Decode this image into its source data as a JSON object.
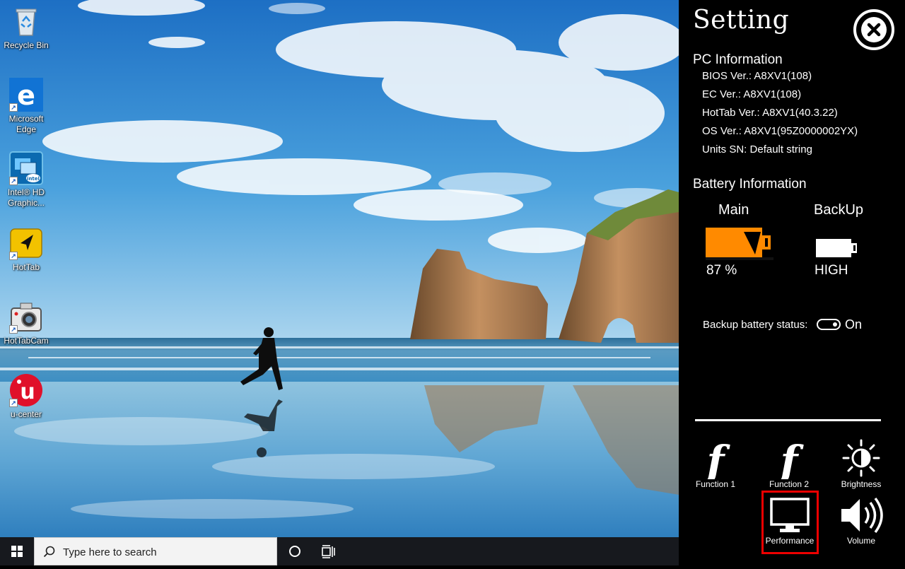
{
  "desktop": {
    "icons": [
      {
        "label": "Recycle Bin",
        "icon": "recycle-bin-icon"
      },
      {
        "label": "Microsoft Edge",
        "icon": "edge-icon"
      },
      {
        "label": "Intel® HD Graphic...",
        "icon": "intel-graphics-icon"
      },
      {
        "label": "HotTab",
        "icon": "hottab-icon"
      },
      {
        "label": "HotTabCam",
        "icon": "camera-icon"
      },
      {
        "label": "u-center",
        "icon": "u-center-icon"
      }
    ]
  },
  "taskbar": {
    "search_placeholder": "Type here to search",
    "icons": [
      "windows-start-icon",
      "search-icon",
      "cortana-icon",
      "task-view-icon"
    ]
  },
  "settings": {
    "title": "Setting",
    "pc_info": {
      "heading": "PC Information",
      "lines": [
        {
          "key": "BIOS Ver.:",
          "value": "A8XV1(108)"
        },
        {
          "key": "EC Ver.:",
          "value": "A8XV1(108)"
        },
        {
          "key": "HotTab Ver.:",
          "value": "A8XV1(40.3.22)"
        },
        {
          "key": "OS Ver.:",
          "value": "A8XV1(95Z0000002YX)"
        },
        {
          "key": "Units SN:",
          "value": "Default string"
        }
      ]
    },
    "battery": {
      "heading": "Battery Information",
      "main_label": "Main",
      "main_value": "87 %",
      "main_level": 0.87,
      "main_color": "#ff8a00",
      "backup_label": "BackUp",
      "backup_value": "HIGH",
      "backup_color": "#ffffff"
    },
    "backup_status": {
      "label": "Backup battery status:",
      "state": "On"
    },
    "tiles": [
      {
        "label": "Function 1",
        "icon": "function-icon"
      },
      {
        "label": "Function 2",
        "icon": "function-icon"
      },
      {
        "label": "Brightness",
        "icon": "brightness-icon"
      },
      {
        "label": "Performance",
        "icon": "monitor-icon",
        "highlighted": true
      },
      {
        "label": "Volume",
        "icon": "speaker-icon"
      }
    ],
    "highlight_color": "#e00000"
  }
}
